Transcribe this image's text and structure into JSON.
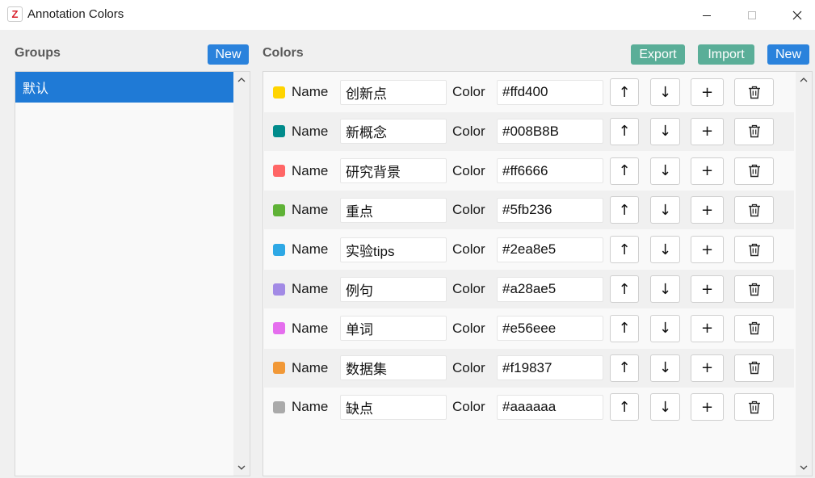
{
  "window": {
    "title": "Annotation Colors",
    "app_icon_letter": "Z"
  },
  "groups": {
    "heading": "Groups",
    "new_label": "New",
    "items": [
      "默认"
    ],
    "selected_index": 0
  },
  "colors": {
    "heading": "Colors",
    "export_label": "Export",
    "import_label": "Import",
    "new_label": "New",
    "name_label": "Name",
    "color_label": "Color",
    "up_glyph": "↑",
    "down_glyph": "↓",
    "add_glyph": "+",
    "rows": [
      {
        "name": "创新点",
        "color": "#ffd400"
      },
      {
        "name": "新概念",
        "color": "#008B8B"
      },
      {
        "name": "研究背景",
        "color": "#ff6666"
      },
      {
        "name": "重点",
        "color": "#5fb236"
      },
      {
        "name": "实验tips",
        "color": "#2ea8e5"
      },
      {
        "name": "例句",
        "color": "#a28ae5"
      },
      {
        "name": "单词",
        "color": "#e56eee"
      },
      {
        "name": "数据集",
        "color": "#f19837"
      },
      {
        "name": "缺点",
        "color": "#aaaaaa"
      }
    ]
  },
  "theme": {
    "accent_blue": "#2a82dc",
    "accent_green": "#5aae98",
    "selection_blue": "#1f7ad6"
  }
}
